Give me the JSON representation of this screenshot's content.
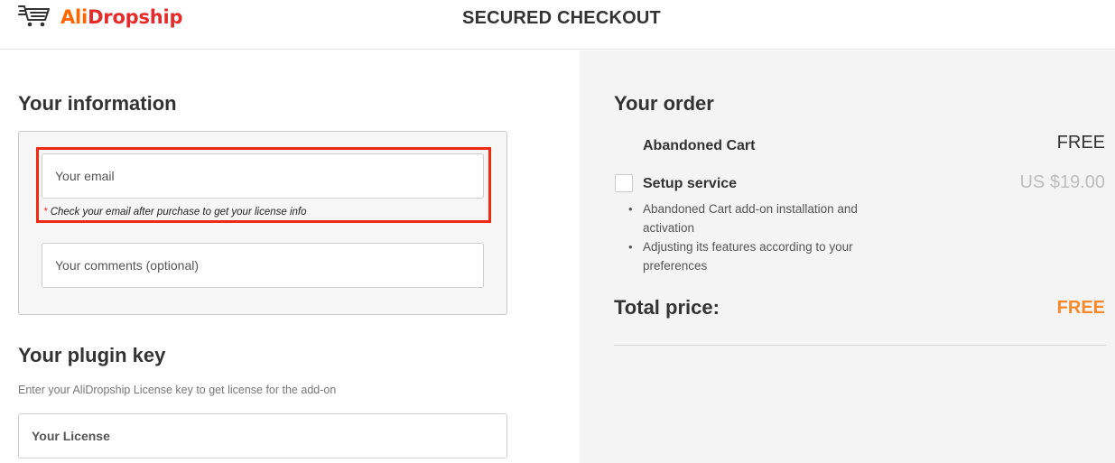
{
  "header": {
    "brand_ali": "Ali",
    "brand_dropship": "Dropship",
    "title": "SECURED CHECKOUT"
  },
  "info": {
    "title": "Your information",
    "email_placeholder": "Your email",
    "email_hint_star": "*",
    "email_hint": "Check your email after purchase to get your license info",
    "comments_placeholder": "Your comments (optional)"
  },
  "plugin": {
    "title": "Your plugin key",
    "subtitle": "Enter your AliDropship License key to get license for the add-on",
    "license_placeholder": "Your License"
  },
  "order": {
    "title": "Your order",
    "items": [
      {
        "name": "Abandoned Cart",
        "price": "FREE"
      },
      {
        "name": "Setup service",
        "price": "US $19.00",
        "selected": false
      }
    ],
    "setup_bullets": [
      "Abandoned Cart add-on installation and activation",
      "Adjusting its features according to your preferences"
    ],
    "total_label": "Total price:",
    "total_value": "FREE"
  },
  "colors": {
    "brand_orange": "#ff6600",
    "brand_red": "#e52b2b",
    "highlight_red": "#ee2a14",
    "total_orange": "#f7892b",
    "panel_gray": "#f4f4f4"
  },
  "icons": {
    "logo": "shopping-cart-icon"
  }
}
